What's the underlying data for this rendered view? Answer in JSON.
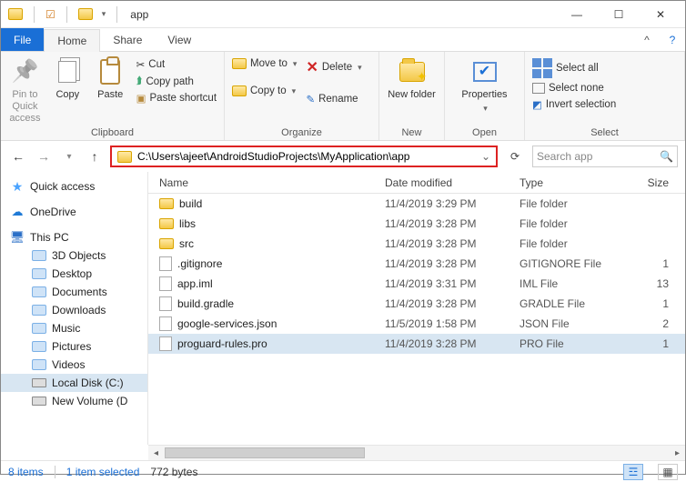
{
  "window": {
    "title": "app"
  },
  "tabs": {
    "file": "File",
    "home": "Home",
    "share": "Share",
    "view": "View"
  },
  "ribbon": {
    "pin": "Pin to Quick access",
    "copy": "Copy",
    "paste": "Paste",
    "cut": "Cut",
    "copy_path": "Copy path",
    "paste_shortcut": "Paste shortcut",
    "clipboard_label": "Clipboard",
    "move_to": "Move to",
    "copy_to": "Copy to",
    "delete": "Delete",
    "rename": "Rename",
    "organize_label": "Organize",
    "new_folder": "New folder",
    "new_label": "New",
    "properties": "Properties",
    "open_label": "Open",
    "select_all": "Select all",
    "select_none": "Select none",
    "invert_selection": "Invert selection",
    "select_label": "Select"
  },
  "address": {
    "path": "C:\\Users\\ajeet\\AndroidStudioProjects\\MyApplication\\app",
    "search_placeholder": "Search app"
  },
  "columns": {
    "name": "Name",
    "date": "Date modified",
    "type": "Type",
    "size": "Size"
  },
  "files": [
    {
      "name": "build",
      "date": "11/4/2019 3:29 PM",
      "type": "File folder",
      "size": "",
      "icon": "folder"
    },
    {
      "name": "libs",
      "date": "11/4/2019 3:28 PM",
      "type": "File folder",
      "size": "",
      "icon": "folder"
    },
    {
      "name": "src",
      "date": "11/4/2019 3:28 PM",
      "type": "File folder",
      "size": "",
      "icon": "folder"
    },
    {
      "name": ".gitignore",
      "date": "11/4/2019 3:28 PM",
      "type": "GITIGNORE File",
      "size": "1",
      "icon": "file"
    },
    {
      "name": "app.iml",
      "date": "11/4/2019 3:31 PM",
      "type": "IML File",
      "size": "13",
      "icon": "file"
    },
    {
      "name": "build.gradle",
      "date": "11/4/2019 3:28 PM",
      "type": "GRADLE File",
      "size": "1",
      "icon": "file"
    },
    {
      "name": "google-services.json",
      "date": "11/5/2019 1:58 PM",
      "type": "JSON File",
      "size": "2",
      "icon": "file"
    },
    {
      "name": "proguard-rules.pro",
      "date": "11/4/2019 3:28 PM",
      "type": "PRO File",
      "size": "1",
      "icon": "file",
      "selected": true
    }
  ],
  "sidebar": {
    "quick_access": "Quick access",
    "onedrive": "OneDrive",
    "this_pc": "This PC",
    "items": [
      "3D Objects",
      "Desktop",
      "Documents",
      "Downloads",
      "Music",
      "Pictures",
      "Videos",
      "Local Disk (C:)",
      "New Volume (D"
    ]
  },
  "status": {
    "items": "8 items",
    "selected": "1 item selected",
    "size": "772 bytes"
  }
}
